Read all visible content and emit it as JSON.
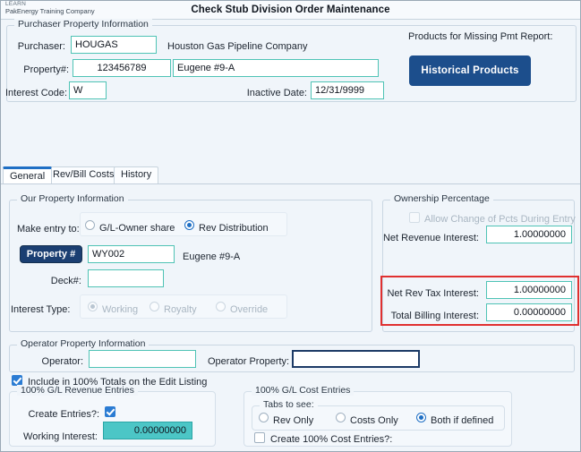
{
  "window": {
    "title": "Check Stub Division Order Maintenance",
    "logo_line1": "LEARN",
    "logo_line2": "PakEnergy Training Company"
  },
  "purchaser_section": {
    "legend": "Purchaser Property Information",
    "purchaser_label": "Purchaser:",
    "purchaser_value": "HOUGAS",
    "purchaser_name": "Houston Gas Pipeline Company",
    "property_label": "Property#:",
    "property_value": "123456789",
    "property_name": "Eugene #9-A",
    "interest_code_label": "Interest Code:",
    "interest_code_value": "W",
    "inactive_date_label": "Inactive Date:",
    "inactive_date_value": "12/31/9999"
  },
  "missing_pmt": {
    "label": "Products for Missing Pmt Report:",
    "button_label": "Historical Products"
  },
  "tabs": [
    {
      "label": "General",
      "active": true
    },
    {
      "label": "Rev/Bill Costs",
      "active": false
    },
    {
      "label": "History",
      "active": false
    }
  ],
  "our_property": {
    "legend": "Our Property Information",
    "make_entry_label": "Make entry to:",
    "radio_gl_owner": "G/L-Owner share",
    "radio_rev_dist": "Rev Distribution",
    "property_badge": "Property #",
    "property_value": "WY002",
    "property_name": "Eugene #9-A",
    "deck_label": "Deck#:",
    "deck_value": "",
    "interest_type_label": "Interest Type:",
    "radio_working": "Working",
    "radio_royalty": "Royalty",
    "radio_override": "Override"
  },
  "ownership": {
    "legend": "Ownership Percentage",
    "allow_change_label": "Allow Change of Pcts During Entry",
    "net_revenue_label": "Net Revenue Interest:",
    "net_revenue_value": "1.00000000",
    "net_rev_tax_label": "Net Rev Tax Interest:",
    "net_rev_tax_value": "1.00000000",
    "total_billing_label": "Total Billing Interest:",
    "total_billing_value": "0.00000000"
  },
  "operator": {
    "legend": "Operator Property Information",
    "operator_label": "Operator:",
    "operator_value": "",
    "operator_property_label": "Operator Property:",
    "operator_property_value": ""
  },
  "bottom": {
    "include_totals_label": "Include in 100% Totals on the Edit Listing",
    "revenue_legend": "100% G/L Revenue Entries",
    "create_entries_label": "Create Entries?:",
    "working_interest_label": "Working Interest:",
    "working_interest_value": "0.00000000",
    "cost_legend": "100% G/L Cost Entries",
    "tabs_to_see_legend": "Tabs to see:",
    "radio_rev_only": "Rev Only",
    "radio_costs_only": "Costs Only",
    "radio_both": "Both if defined",
    "create_cost_entries_label": "Create 100% Cost Entries?:"
  },
  "colors": {
    "accent_blue": "#1c4e8c",
    "badge_navy": "#1b3f72",
    "field_teal_border": "#4fc3b5",
    "teal_fill": "#4cc6c6",
    "checkbox_blue": "#2b7cd3",
    "highlight_red": "#e03030",
    "background": "#f0f5fa"
  }
}
